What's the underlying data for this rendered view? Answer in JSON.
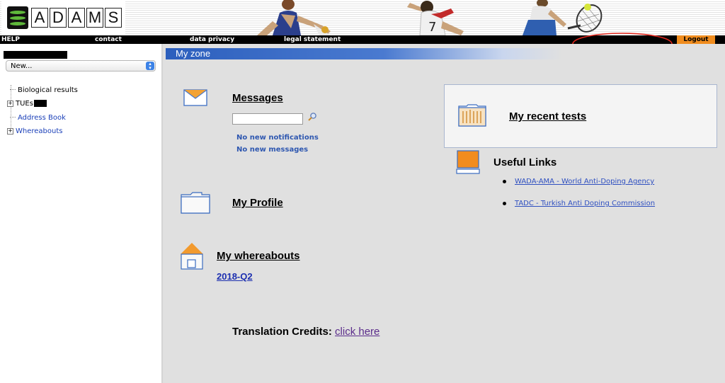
{
  "header": {
    "logo_letters": [
      "A",
      "D",
      "A",
      "M",
      "S"
    ]
  },
  "nav": {
    "help": "HELP",
    "contact": "contact",
    "data_privacy": "data privacy",
    "legal_statement": "legal statement",
    "logout": "Logout"
  },
  "sidebar": {
    "new_select_value": "New...",
    "items": [
      {
        "label": "Biological results"
      },
      {
        "label": "TUEs"
      },
      {
        "label": "Address Book"
      },
      {
        "label": "Whereabouts"
      }
    ]
  },
  "main": {
    "zone_title": "My zone",
    "messages": {
      "title": "Messages",
      "no_notifications": "No new notifications",
      "no_messages": "No new messages"
    },
    "profile_title": "My Profile",
    "whereabouts": {
      "title": "My whereabouts",
      "quarter": "2018-Q2"
    },
    "credits": {
      "label": "Translation Credits:",
      "link": "click here"
    },
    "recent_tests_title": "My recent tests",
    "useful_links": {
      "title": "Useful Links",
      "links": [
        {
          "label": "WADA-AMA - World Anti-Doping Agency"
        },
        {
          "label": "TADC - Turkish Anti Doping Commission"
        }
      ]
    }
  },
  "colors": {
    "accent_blue": "#2c5fbd",
    "logout_orange": "#f08c1e",
    "annotation_red": "#e0281e",
    "logo_green": "#5fb83b"
  },
  "icons": [
    "search-icon",
    "envelope-icon",
    "folder-icon",
    "house-icon",
    "recent-tests-icon",
    "monitor-icon"
  ]
}
